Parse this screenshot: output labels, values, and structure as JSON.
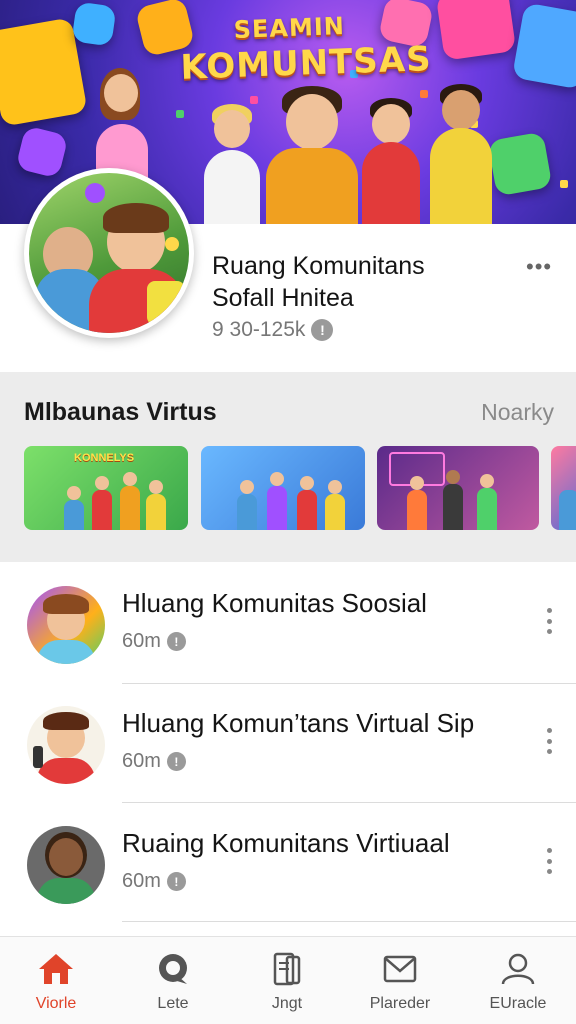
{
  "banner": {
    "title_line1": "SEAMIN",
    "title_line2": "KOMUNTSAS"
  },
  "profile": {
    "title_line1": "Ruang Komunitans",
    "title_line2": "Sofall Hnitea",
    "meta": "9 30-125k",
    "info_icon": "!"
  },
  "featured": {
    "title": "Mlbaunas Virtus",
    "see_all": "Noarky",
    "thumb_label": "KONNELYS"
  },
  "list": [
    {
      "title": "Hluang Komunitas Soosial",
      "meta": "60m",
      "icon": "!"
    },
    {
      "title": "Hluang Komun’tans Virtual Sip",
      "meta": "60m",
      "icon": "!"
    },
    {
      "title": "Ruaing Komunitans Virtiuaal",
      "meta": "60m",
      "icon": "!"
    }
  ],
  "nav": [
    {
      "label": "Viorle",
      "icon": "home-icon",
      "active": true
    },
    {
      "label": "Lete",
      "icon": "chat-icon",
      "active": false
    },
    {
      "label": "Jngt",
      "icon": "document-icon",
      "active": false
    },
    {
      "label": "Plareder",
      "icon": "mail-icon",
      "active": false
    },
    {
      "label": "EUracle",
      "icon": "profile-icon",
      "active": false
    }
  ],
  "colors": {
    "accent": "#e0442a",
    "banner_bg": "#3a2aa8",
    "title_gold": "#ffd84a"
  }
}
